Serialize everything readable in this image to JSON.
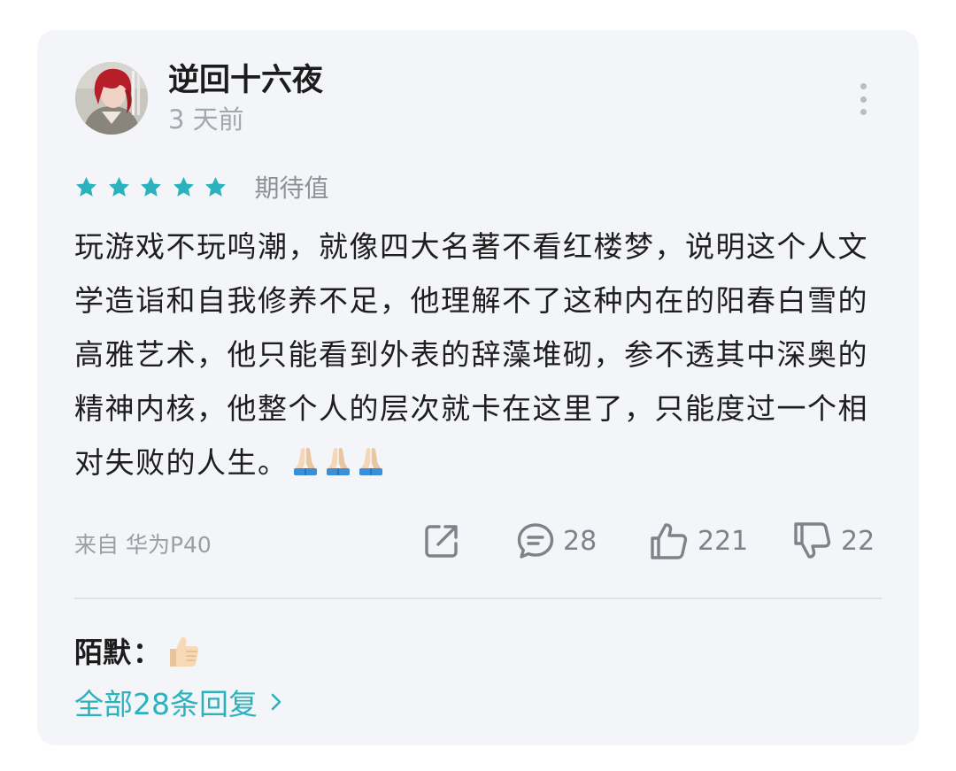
{
  "comment": {
    "username": "逆回十六夜",
    "timestamp": "3 天前",
    "rating": 5,
    "rating_label": "期待值",
    "text": "玩游戏不玩鸣潮，就像四大名著不看红楼梦，说明这个人文学造诣和自我修养不足，他理解不了这种内在的阳春白雪的高雅艺术，他只能看到外表的辞藻堆砌，参不透其中深奥的精神内核，他整个人的层次就卡在这里了，只能度过一个相对失败的人生。",
    "text_emojis": [
      "folded-hands-icon",
      "folded-hands-icon",
      "folded-hands-icon"
    ],
    "device": "来自 华为P40",
    "share_icon": "share-icon",
    "reply_count": "28",
    "like_count": "221",
    "dislike_count": "22"
  },
  "reply_preview": {
    "author": "陌默",
    "separator": "：",
    "emoji": "thumbs-up-icon"
  },
  "all_replies_link": "全部28条回复",
  "colors": {
    "accent": "#2bb3bd",
    "card_bg": "#f3f5f8",
    "muted_text": "#a4a8ae",
    "icon_gray": "#7f8389"
  }
}
